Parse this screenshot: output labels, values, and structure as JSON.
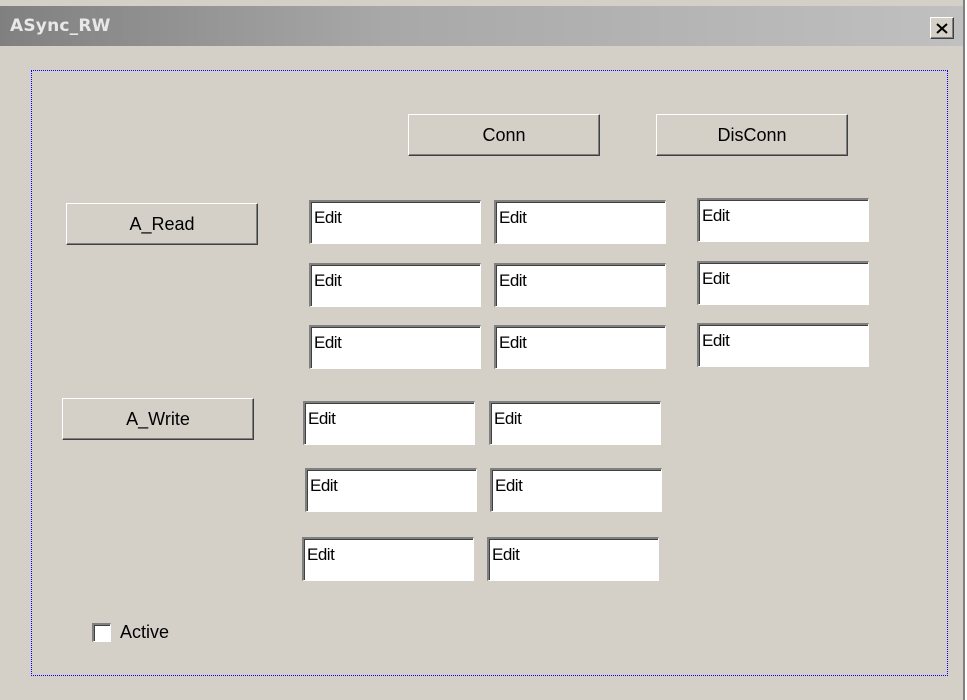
{
  "window": {
    "title": "ASync_RW",
    "close_glyph": "✕"
  },
  "buttons": {
    "conn": "Conn",
    "disconn": "DisConn",
    "a_read": "A_Read",
    "a_write": "A_Write"
  },
  "read_edits": [
    [
      "Edit",
      "Edit",
      "Edit"
    ],
    [
      "Edit",
      "Edit",
      "Edit"
    ],
    [
      "Edit",
      "Edit",
      "Edit"
    ]
  ],
  "write_edits": [
    [
      "Edit",
      "Edit"
    ],
    [
      "Edit",
      "Edit"
    ],
    [
      "Edit",
      "Edit"
    ]
  ],
  "active": {
    "label": "Active",
    "checked": false
  },
  "colors": {
    "face": "#d4d0c8",
    "group_border": "#0000ff"
  }
}
